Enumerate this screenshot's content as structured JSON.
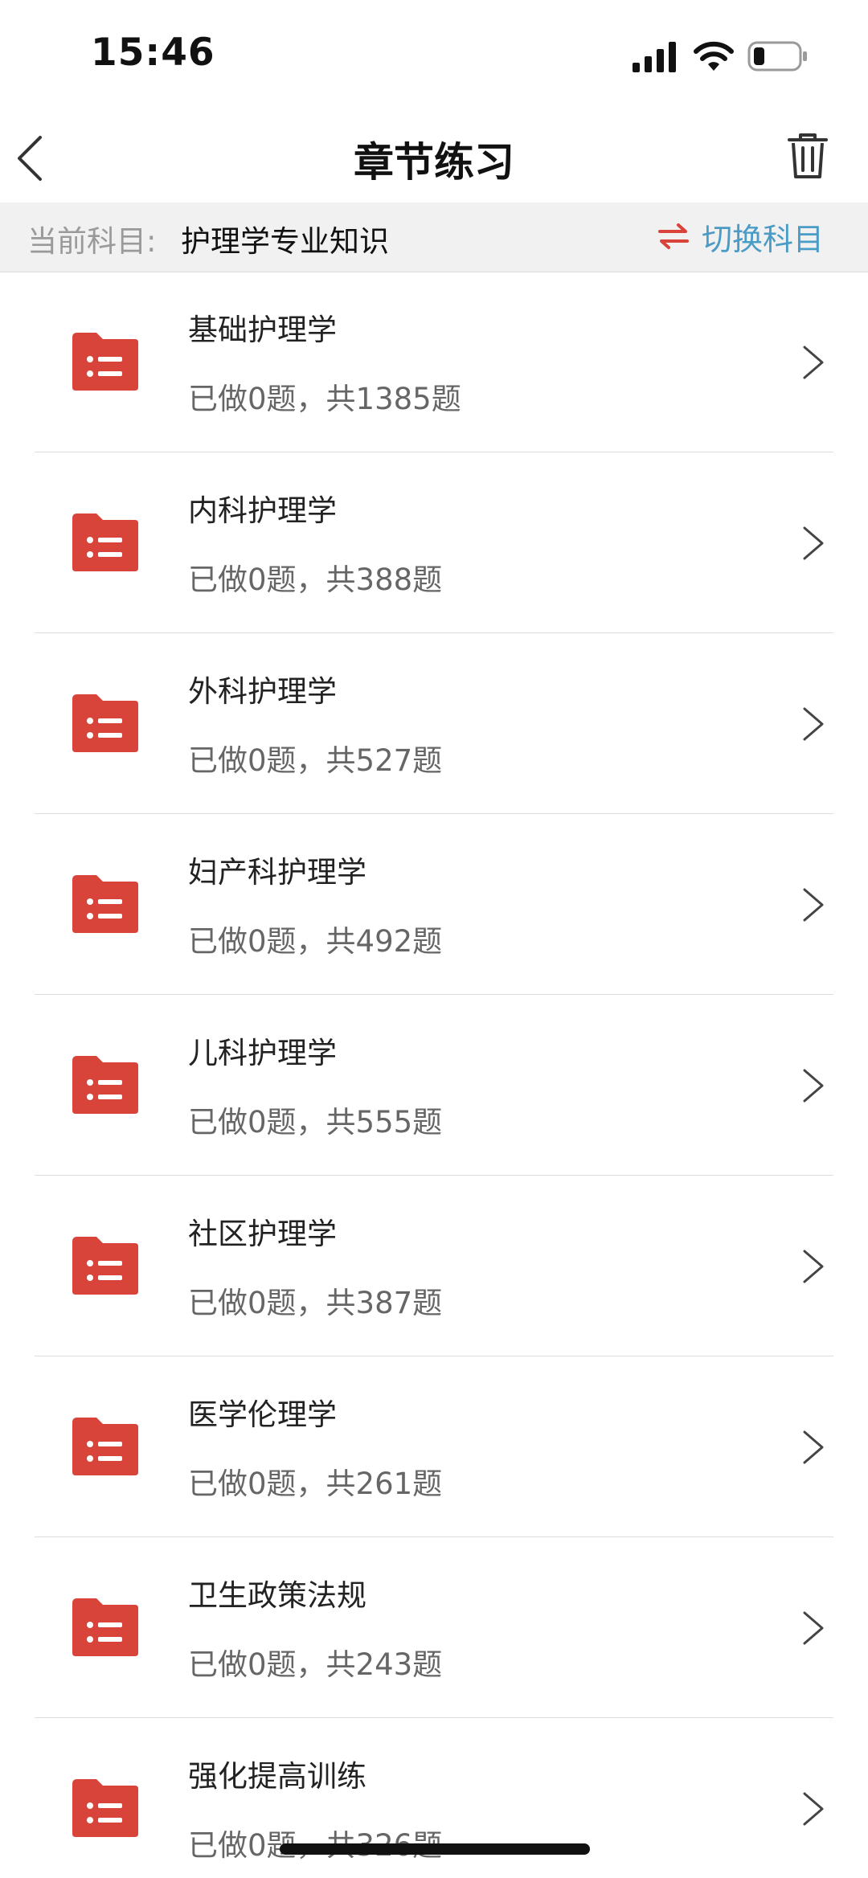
{
  "status": {
    "time": "15:46"
  },
  "nav": {
    "title": "章节练习"
  },
  "subject": {
    "label": "当前科目:",
    "value": "护理学专业知识",
    "switch_label": "切换科目"
  },
  "items": [
    {
      "title": "基础护理学",
      "subtitle": "已做0题，共1385题"
    },
    {
      "title": "内科护理学",
      "subtitle": "已做0题，共388题"
    },
    {
      "title": "外科护理学",
      "subtitle": "已做0题，共527题"
    },
    {
      "title": "妇产科护理学",
      "subtitle": "已做0题，共492题"
    },
    {
      "title": "儿科护理学",
      "subtitle": "已做0题，共555题"
    },
    {
      "title": "社区护理学",
      "subtitle": "已做0题，共387题"
    },
    {
      "title": "医学伦理学",
      "subtitle": "已做0题，共261题"
    },
    {
      "title": "卫生政策法规",
      "subtitle": "已做0题，共243题"
    },
    {
      "title": "强化提高训练",
      "subtitle": "已做0题，共326题"
    }
  ],
  "icons": {
    "back": "chevron-left-icon",
    "trash": "trash-icon",
    "switch": "swap-arrows-icon",
    "folder": "folder-list-icon",
    "chevron": "chevron-right-icon"
  },
  "colors": {
    "accent_red": "#d9443a",
    "link_blue": "#4a9cc7",
    "subject_bar_bg": "#f1f1f1"
  }
}
